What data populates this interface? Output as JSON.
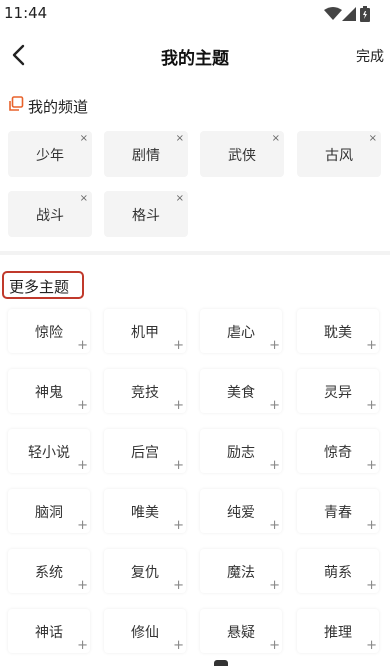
{
  "status_bar": {
    "time": "11:44",
    "icons": [
      "wifi-icon",
      "signal-icon",
      "battery-icon"
    ]
  },
  "header": {
    "back_icon": "chevron-left-icon",
    "title": "我的主题",
    "done_label": "完成"
  },
  "my_channel": {
    "icon": "copy-icon",
    "icon_color": "#e8622b",
    "title": "我的频道",
    "remove_symbol": "×",
    "items": [
      {
        "label": "少年"
      },
      {
        "label": "剧情"
      },
      {
        "label": "武侠"
      },
      {
        "label": "古风"
      },
      {
        "label": "战斗"
      },
      {
        "label": "格斗"
      }
    ]
  },
  "more_topics": {
    "title": "更多主题",
    "highlight_color": "#c0392b",
    "add_symbol": "+",
    "items": [
      {
        "label": "惊险"
      },
      {
        "label": "机甲"
      },
      {
        "label": "虐心"
      },
      {
        "label": "耽美"
      },
      {
        "label": "神鬼"
      },
      {
        "label": "竞技"
      },
      {
        "label": "美食"
      },
      {
        "label": "灵异"
      },
      {
        "label": "轻小说"
      },
      {
        "label": "后宫"
      },
      {
        "label": "励志"
      },
      {
        "label": "惊奇"
      },
      {
        "label": "脑洞"
      },
      {
        "label": "唯美"
      },
      {
        "label": "纯爱"
      },
      {
        "label": "青春"
      },
      {
        "label": "系统"
      },
      {
        "label": "复仇"
      },
      {
        "label": "魔法"
      },
      {
        "label": "萌系"
      },
      {
        "label": "神话"
      },
      {
        "label": "修仙"
      },
      {
        "label": "悬疑"
      },
      {
        "label": "推理"
      }
    ]
  }
}
